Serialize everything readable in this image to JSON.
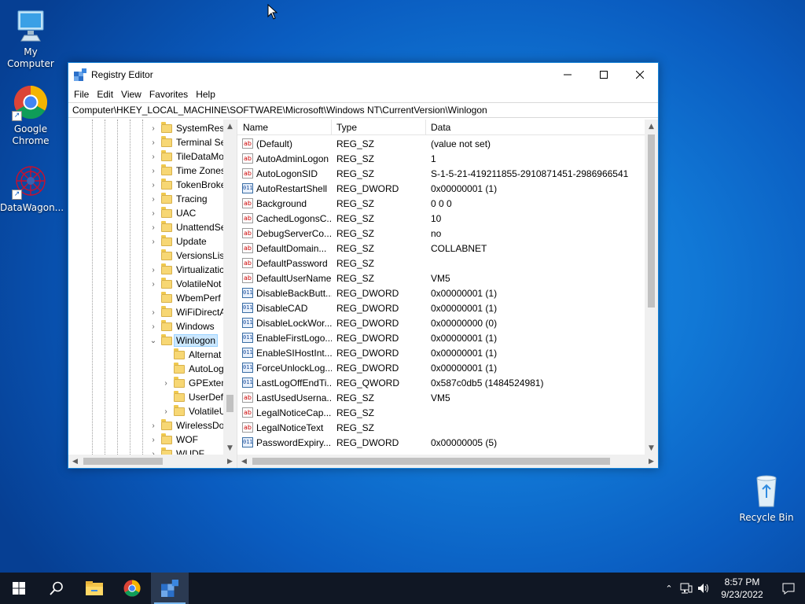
{
  "desktop": {
    "icons": [
      {
        "label": "My Computer",
        "icon": "monitor-icon"
      },
      {
        "label": "Google Chrome",
        "icon": "chrome-icon"
      },
      {
        "label": "DataWagon...",
        "icon": "datawagon-icon"
      },
      {
        "label": "Recycle Bin",
        "icon": "recycle-bin-icon"
      }
    ]
  },
  "window": {
    "title": "Registry Editor",
    "menu": [
      "File",
      "Edit",
      "View",
      "Favorites",
      "Help"
    ],
    "address": "Computer\\HKEY_LOCAL_MACHINE\\SOFTWARE\\Microsoft\\Windows NT\\CurrentVersion\\Winlogon",
    "tree": [
      {
        "label": "SystemRest",
        "expander": "›"
      },
      {
        "label": "Terminal Se",
        "expander": "›"
      },
      {
        "label": "TileDataMo",
        "expander": "›"
      },
      {
        "label": "Time Zones",
        "expander": "›"
      },
      {
        "label": "TokenBroke",
        "expander": "›"
      },
      {
        "label": "Tracing",
        "expander": "›"
      },
      {
        "label": "UAC",
        "expander": "›"
      },
      {
        "label": "UnattendSe",
        "expander": "›"
      },
      {
        "label": "Update",
        "expander": "›"
      },
      {
        "label": "VersionsList",
        "expander": ""
      },
      {
        "label": "Virtualizatic",
        "expander": "›"
      },
      {
        "label": "VolatileNot",
        "expander": "›"
      },
      {
        "label": "WbemPerf",
        "expander": ""
      },
      {
        "label": "WiFiDirectA",
        "expander": "›"
      },
      {
        "label": "Windows",
        "expander": "›"
      },
      {
        "label": "Winlogon",
        "expander": "⌄",
        "selected": true
      },
      {
        "label": "Alternat",
        "expander": "",
        "child": true
      },
      {
        "label": "AutoLog",
        "expander": "",
        "child": true
      },
      {
        "label": "GPExten",
        "expander": "›",
        "child": true
      },
      {
        "label": "UserDef",
        "expander": "",
        "child": true
      },
      {
        "label": "VolatileU",
        "expander": "›",
        "child": true
      },
      {
        "label": "WirelessDo",
        "expander": "›"
      },
      {
        "label": "WOF",
        "expander": "›"
      },
      {
        "label": "WUDF",
        "expander": "›"
      }
    ],
    "columns": {
      "name": "Name",
      "type": "Type",
      "data": "Data"
    },
    "values": [
      {
        "name": "(Default)",
        "type": "REG_SZ",
        "data": "(value not set)",
        "icon": "ab"
      },
      {
        "name": "AutoAdminLogon",
        "type": "REG_SZ",
        "data": "1",
        "icon": "ab"
      },
      {
        "name": "AutoLogonSID",
        "type": "REG_SZ",
        "data": "S-1-5-21-419211855-2910871451-2986966541",
        "icon": "ab"
      },
      {
        "name": "AutoRestartShell",
        "type": "REG_DWORD",
        "data": "0x00000001 (1)",
        "icon": "bin"
      },
      {
        "name": "Background",
        "type": "REG_SZ",
        "data": "0 0 0",
        "icon": "ab"
      },
      {
        "name": "CachedLogonsC...",
        "type": "REG_SZ",
        "data": "10",
        "icon": "ab"
      },
      {
        "name": "DebugServerCo...",
        "type": "REG_SZ",
        "data": "no",
        "icon": "ab"
      },
      {
        "name": "DefaultDomain...",
        "type": "REG_SZ",
        "data": "COLLABNET",
        "icon": "ab"
      },
      {
        "name": "DefaultPassword",
        "type": "REG_SZ",
        "data": "",
        "icon": "ab"
      },
      {
        "name": "DefaultUserName",
        "type": "REG_SZ",
        "data": "VM5",
        "icon": "ab"
      },
      {
        "name": "DisableBackButt...",
        "type": "REG_DWORD",
        "data": "0x00000001 (1)",
        "icon": "bin"
      },
      {
        "name": "DisableCAD",
        "type": "REG_DWORD",
        "data": "0x00000001 (1)",
        "icon": "bin"
      },
      {
        "name": "DisableLockWor...",
        "type": "REG_DWORD",
        "data": "0x00000000 (0)",
        "icon": "bin"
      },
      {
        "name": "EnableFirstLogo...",
        "type": "REG_DWORD",
        "data": "0x00000001 (1)",
        "icon": "bin"
      },
      {
        "name": "EnableSIHostInt...",
        "type": "REG_DWORD",
        "data": "0x00000001 (1)",
        "icon": "bin"
      },
      {
        "name": "ForceUnlockLog...",
        "type": "REG_DWORD",
        "data": "0x00000001 (1)",
        "icon": "bin"
      },
      {
        "name": "LastLogOffEndTi...",
        "type": "REG_QWORD",
        "data": "0x587c0db5 (1484524981)",
        "icon": "bin"
      },
      {
        "name": "LastUsedUserna...",
        "type": "REG_SZ",
        "data": "VM5",
        "icon": "ab"
      },
      {
        "name": "LegalNoticeCap...",
        "type": "REG_SZ",
        "data": "",
        "icon": "ab"
      },
      {
        "name": "LegalNoticeText",
        "type": "REG_SZ",
        "data": "",
        "icon": "ab"
      },
      {
        "name": "PasswordExpiry...",
        "type": "REG_DWORD",
        "data": "0x00000005 (5)",
        "icon": "bin"
      }
    ]
  },
  "taskbar": {
    "apps": [
      "start-icon",
      "search-icon",
      "file-explorer-icon",
      "chrome-icon",
      "datawagon-icon"
    ],
    "time": "8:57 PM",
    "date": "9/23/2022"
  }
}
